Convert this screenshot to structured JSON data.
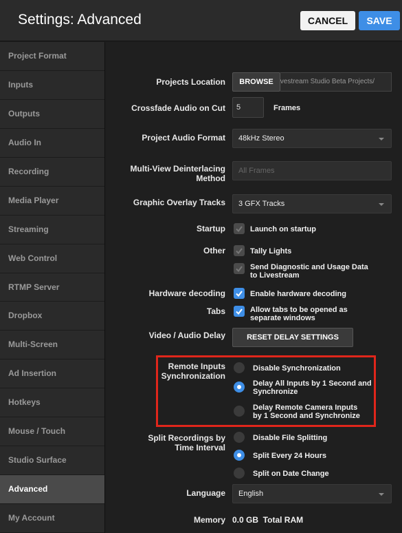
{
  "header": {
    "title": "Settings: Advanced",
    "cancel_label": "CANCEL",
    "save_label": "SAVE"
  },
  "sidebar": {
    "items": [
      {
        "label": "Project Format"
      },
      {
        "label": "Inputs"
      },
      {
        "label": "Outputs"
      },
      {
        "label": "Audio In"
      },
      {
        "label": "Recording"
      },
      {
        "label": "Media Player"
      },
      {
        "label": "Streaming"
      },
      {
        "label": "Web Control"
      },
      {
        "label": "RTMP Server"
      },
      {
        "label": "Dropbox"
      },
      {
        "label": "Multi-Screen"
      },
      {
        "label": "Ad Insertion"
      },
      {
        "label": "Hotkeys"
      },
      {
        "label": "Mouse / Touch"
      },
      {
        "label": "Studio Surface"
      },
      {
        "label": "Advanced"
      },
      {
        "label": "My Account"
      }
    ],
    "active": "Advanced"
  },
  "settings": {
    "projects_location": {
      "label": "Projects Location",
      "browse_label": "BROWSE",
      "path_value": "Livestream Studio Beta Projects/"
    },
    "crossfade": {
      "label": "Crossfade Audio on Cut",
      "value": "5",
      "unit": "Frames"
    },
    "audio_format": {
      "label": "Project Audio Format",
      "value": "48kHz Stereo"
    },
    "deinterlacing": {
      "label_line1": "Multi-View Deinterlacing",
      "label_line2": "Method",
      "value": "All Frames"
    },
    "overlay_tracks": {
      "label": "Graphic Overlay Tracks",
      "value": "3 GFX Tracks"
    },
    "startup": {
      "label": "Startup",
      "option": "Launch on startup",
      "checked": false
    },
    "other": {
      "label": "Other",
      "tally": "Tally Lights",
      "tally_checked": false,
      "diag_line1": "Send Diagnostic and Usage Data",
      "diag_line2": "to Livestream",
      "diag_checked": false
    },
    "hw_decoding": {
      "label": "Hardware decoding",
      "option": "Enable hardware decoding",
      "checked": true
    },
    "tabs": {
      "label": "Tabs",
      "option_line1": "Allow tabs to be opened as",
      "option_line2": "separate windows",
      "checked": true
    },
    "av_delay": {
      "label": "Video / Audio Delay",
      "button": "RESET DELAY SETTINGS"
    },
    "remote_sync": {
      "label_line1": "Remote Inputs",
      "label_line2": "Synchronization",
      "opt1": "Disable Synchronization",
      "opt2_line1": "Delay All Inputs by 1 Second and",
      "opt2_line2": "Synchronize",
      "opt3_line1": "Delay Remote Camera Inputs",
      "opt3_line2": "by 1 Second and Synchronize",
      "selected": 2
    },
    "split_recordings": {
      "label_line1": "Split Recordings by",
      "label_line2": "Time Interval",
      "opt1": "Disable File Splitting",
      "opt2": "Split Every 24 Hours",
      "opt3": "Split on Date Change",
      "selected": 2
    },
    "language": {
      "label": "Language",
      "value": "English"
    },
    "memory": {
      "label": "Memory",
      "value": "0.0 GB  Total RAM"
    }
  },
  "colors": {
    "accent": "#3e8ee6",
    "highlight_border": "#e0261b"
  }
}
